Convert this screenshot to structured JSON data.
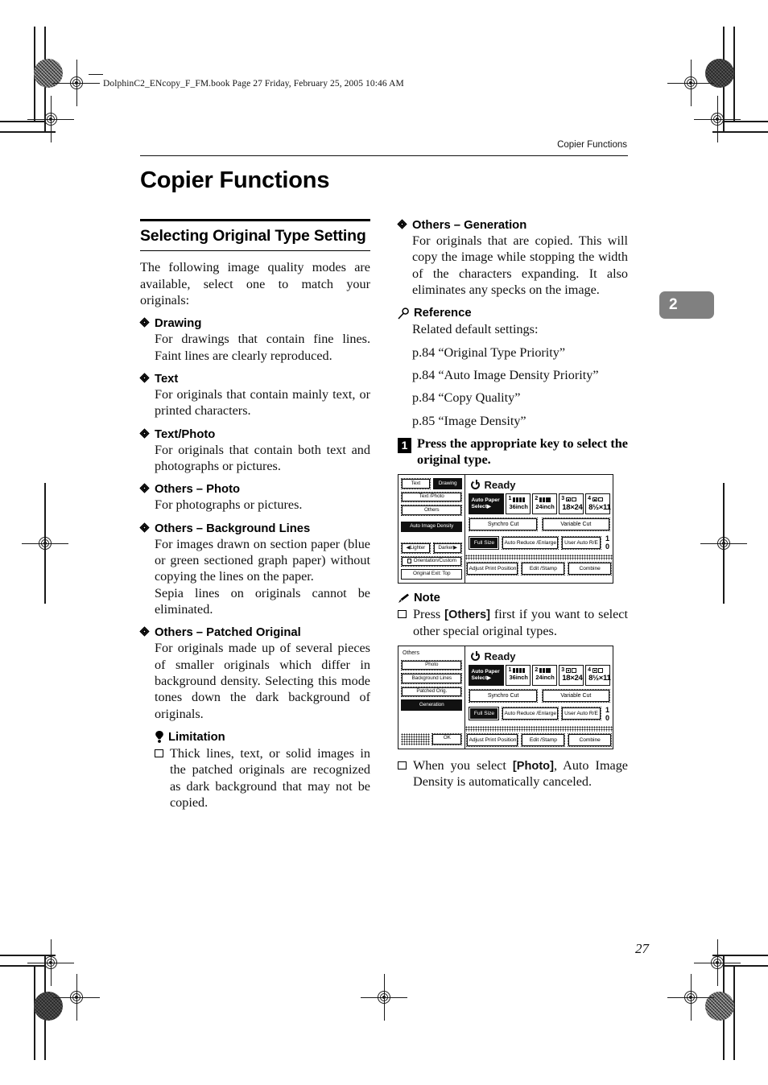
{
  "file_header": "DolphinC2_ENcopy_F_FM.book  Page 27  Friday, February 25, 2005  10:46 AM",
  "running_head": "Copier Functions",
  "chapter_tab": "2",
  "page_number": "27",
  "title": "Copier Functions",
  "left_column": {
    "heading": "Selecting Original Type Setting",
    "intro": "The following image quality modes are available, select one to match your originals:",
    "items": [
      {
        "head": "Drawing",
        "body": "For drawings that contain fine lines. Faint lines are clearly reproduced."
      },
      {
        "head": "Text",
        "body": "For originals that contain mainly text, or printed characters."
      },
      {
        "head": "Text/Photo",
        "body": "For originals that contain both text and photographs or pictures."
      },
      {
        "head": "Others – Photo",
        "body": "For photographs or pictures."
      },
      {
        "head": "Others – Background Lines",
        "body": "For images drawn on section paper (blue or green sectioned graph paper) without copying the lines on the paper.",
        "body2": "Sepia lines on originals cannot be eliminated."
      },
      {
        "head": "Others – Patched Original",
        "body": "For originals made up of several pieces of smaller originals which differ in background density. Selecting this mode tones down the dark background of originals."
      }
    ],
    "limitation": {
      "label": "Limitation",
      "note": "Thick lines, text, or solid images in the patched originals are recognized as dark background that may not be copied."
    }
  },
  "right_column": {
    "generation": {
      "head": "Others – Generation",
      "body": "For originals that are copied. This will copy the image while stopping the width of the characters expanding. It also eliminates any specks on the image."
    },
    "reference": {
      "label": "Reference",
      "intro": "Related default settings:",
      "links": [
        "p.84 “Original Type Priority”",
        "p.84 “Auto Image Density Priority”",
        "p.84 “Copy Quality”",
        "p.85 “Image Density”"
      ]
    },
    "step1": {
      "number": "1",
      "text": "Press the appropriate key to select the original type."
    },
    "note": {
      "label": "Note",
      "item1_pre": "Press ",
      "item1_key": "[Others]",
      "item1_post": " first if you want to select other special original types.",
      "item2_pre": "When you select ",
      "item2_key": "[Photo]",
      "item2_post": ", Auto Image Density is automatically canceled."
    }
  },
  "lcd_panel_1": {
    "status": "Ready",
    "sidebar": {
      "text_key": "Text",
      "drawing_key": "Drawing",
      "text_photo_key": "Text /Photo",
      "others_key": "Others",
      "auto_image_density_key": "Auto Image Density",
      "lighter_key": "◀Lighter",
      "darker_key": "Darker▶",
      "orientation_key": "Orientation/Custom",
      "original_exit_key": "Original Exit: Top"
    },
    "paper": {
      "auto_select_key": "Auto Paper Select▶",
      "trays": [
        {
          "num": "1",
          "size": "36inch"
        },
        {
          "num": "2",
          "size": "24inch"
        },
        {
          "num": "3",
          "size": "18×24"
        },
        {
          "num": "4",
          "size": "8½×11"
        }
      ]
    },
    "cut": {
      "synchro": "Synchro Cut",
      "variable": "Variable Cut"
    },
    "size": {
      "full_size": "Full Size",
      "auto_reduce": "Auto Reduce /Enlarge",
      "user_auto": "User Auto R/E",
      "ratio": "1 0"
    },
    "bottom": {
      "adjust": "Adjust Print Position",
      "edit": "Edit /Stamp",
      "combine": "Combine"
    }
  },
  "lcd_panel_2": {
    "status": "Ready",
    "sidebar": {
      "title": "Others",
      "photo_key": "Photo",
      "background_lines_key": "Background Lines",
      "patched_orig_key": "Patched Orig.",
      "generation_key": "Generation",
      "ok_key": "OK"
    },
    "paper": {
      "auto_select_key": "Auto Paper Select▶",
      "trays": [
        {
          "num": "1",
          "size": "36inch"
        },
        {
          "num": "2",
          "size": "24inch"
        },
        {
          "num": "3",
          "size": "18×24"
        },
        {
          "num": "4",
          "size": "8½×11"
        }
      ]
    },
    "cut": {
      "synchro": "Synchro Cut",
      "variable": "Variable Cut"
    },
    "size": {
      "full_size": "Full Size",
      "auto_reduce": "Auto Reduce /Enlarge",
      "user_auto": "User Auto R/E",
      "ratio": "1 0"
    },
    "bottom": {
      "adjust": "Adjust Print Position",
      "edit": "Edit /Stamp",
      "combine": "Combine"
    }
  }
}
